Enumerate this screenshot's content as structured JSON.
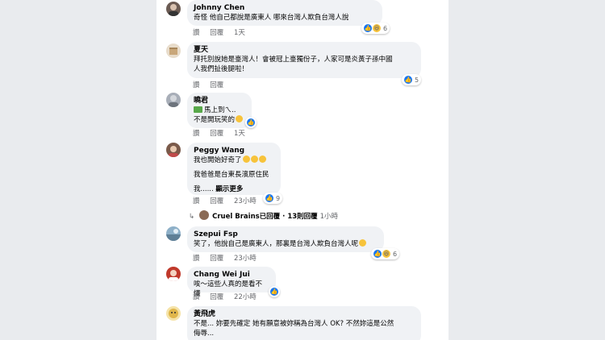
{
  "comments": [
    {
      "name": "Johnny Chen",
      "lines": [
        "奇怪 他自己都說是廣東人 哪來台灣人欺負台灣人說"
      ],
      "actions": [
        "讚",
        "回覆"
      ],
      "time": "1天",
      "reactions": [
        "like",
        "haha"
      ],
      "count": "6",
      "avatar_color": "#6b5b53"
    },
    {
      "name": "夏天",
      "lines": [
        "拜托別說她是臺灣人！會被冠上臺獨份子，人家可是炎黃子孫中國",
        "人我們扯後腿啦！"
      ],
      "actions": [
        "讚",
        "回覆"
      ],
      "time": "",
      "reactions": [
        "like"
      ],
      "count": "5",
      "avatar_color": "#c9a77a"
    },
    {
      "name": "曉君",
      "lines": [
        "馬上到ㄟ..",
        "不是開玩笑的"
      ],
      "actions": [
        "讚",
        "回覆"
      ],
      "time": "1天",
      "reactions": [
        "like"
      ],
      "count": "",
      "avatar_color": "#a8aeb8"
    },
    {
      "name": "Peggy Wang",
      "lines": [
        "我也開始好奇了",
        "我爸爸是台東長濱原住民",
        "我......"
      ],
      "see_more": "顯示更多",
      "actions": [
        "讚",
        "回覆"
      ],
      "time": "23小時",
      "reactions": [
        "like"
      ],
      "count": "9",
      "avatar_color": "#7a5a4a",
      "reply": {
        "text": "Cruel Brains已回覆 · 13則回覆",
        "time": "1小時"
      }
    },
    {
      "name": "Szepui Fsp",
      "lines": [
        "笑了，他說自己是廣東人，那裏是台灣人欺負台灣人呢"
      ],
      "actions": [
        "讚",
        "回覆"
      ],
      "time": "23小時",
      "reactions": [
        "like",
        "haha"
      ],
      "count": "6",
      "avatar_color": "#8eb0c8"
    },
    {
      "name": "Chang Wei Jui",
      "lines": [
        "唉～這些人真的是看不懂"
      ],
      "actions": [
        "讚",
        "回覆"
      ],
      "time": "22小時",
      "reactions": [
        "like"
      ],
      "count": "",
      "avatar_color": "#c0392b"
    },
    {
      "name": "黃飛虎",
      "lines": [
        "不是... 妳要先確定 她有願意被妳稱為台灣人 OK? 不然妳這是公然",
        "侮辱..."
      ],
      "actions": [],
      "time": "",
      "reactions": [],
      "count": "",
      "avatar_color": "#e0b64a"
    }
  ]
}
